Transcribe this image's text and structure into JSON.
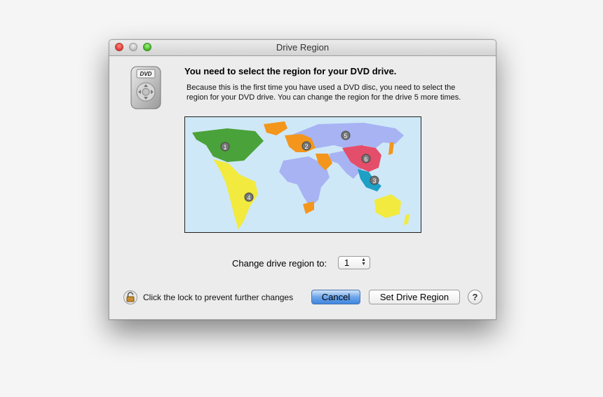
{
  "window": {
    "title": "Drive Region"
  },
  "dialog": {
    "heading": "You need to select the region for your DVD drive.",
    "description": "Because this is the first time you have used a DVD disc, you need to select the region for your DVD drive. You can change the region for the drive 5 more times.",
    "icon": "dvd-player-remote-icon",
    "icon_label": "DVD"
  },
  "map": {
    "regions": [
      {
        "number": "1",
        "name": "north-america",
        "color": "#4aa23a"
      },
      {
        "number": "2",
        "name": "europe-middle-east-japan",
        "color": "#f3961b"
      },
      {
        "number": "3",
        "name": "southeast-asia",
        "color": "#1e9fc6"
      },
      {
        "number": "4",
        "name": "latin-america-oceania",
        "color": "#f2ea3e"
      },
      {
        "number": "5",
        "name": "russia-africa-india",
        "color": "#a7b3f3"
      },
      {
        "number": "6",
        "name": "china",
        "color": "#e44e6a"
      }
    ],
    "ocean_color": "#cfe8f7"
  },
  "region_select": {
    "label": "Change drive region to:",
    "value": "1"
  },
  "footer": {
    "lock_text": "Click the lock to prevent further changes",
    "cancel_label": "Cancel",
    "set_label": "Set Drive Region",
    "help_label": "?"
  }
}
